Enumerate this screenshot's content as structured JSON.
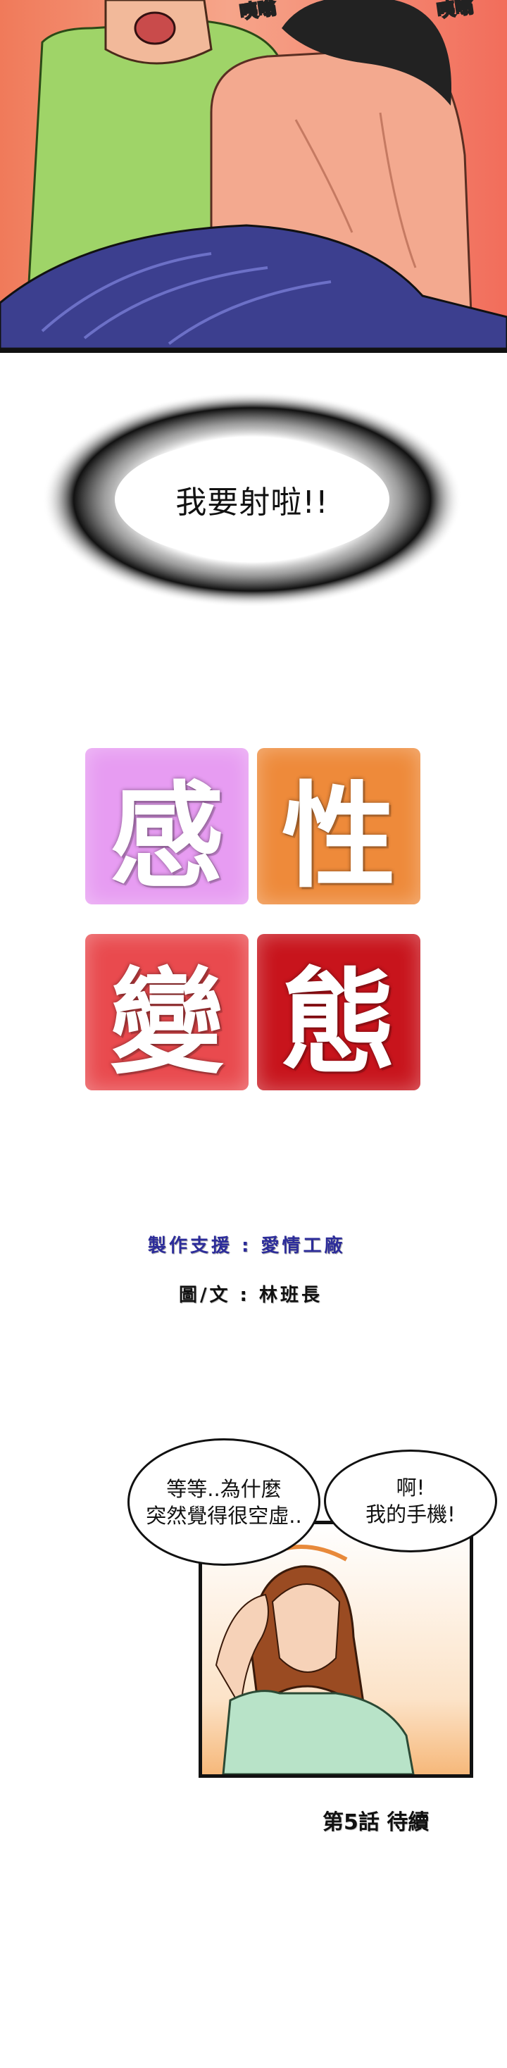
{
  "top_panel": {
    "sfx_left": "咦嗡",
    "sfx_right": "咦嗡"
  },
  "shout": {
    "text": "我要射啦!!"
  },
  "logo": {
    "tiles": [
      {
        "char": "感",
        "color": "#e79cf2"
      },
      {
        "char": "性",
        "color": "#ee8a3a"
      },
      {
        "char": "變",
        "color": "#e94a4e"
      },
      {
        "char": "態",
        "color": "#c8141c"
      }
    ]
  },
  "credits": {
    "production": "製作支援 : 愛情工廠",
    "art_text": "圖/文 : 林班長"
  },
  "ending_panel": {
    "bubble_left": [
      "等等..為什麼",
      "突然覺得很空虛.."
    ],
    "bubble_right": [
      "啊!",
      "我的手機!"
    ]
  },
  "footer": {
    "to_be_continued": "第5話 待續"
  }
}
